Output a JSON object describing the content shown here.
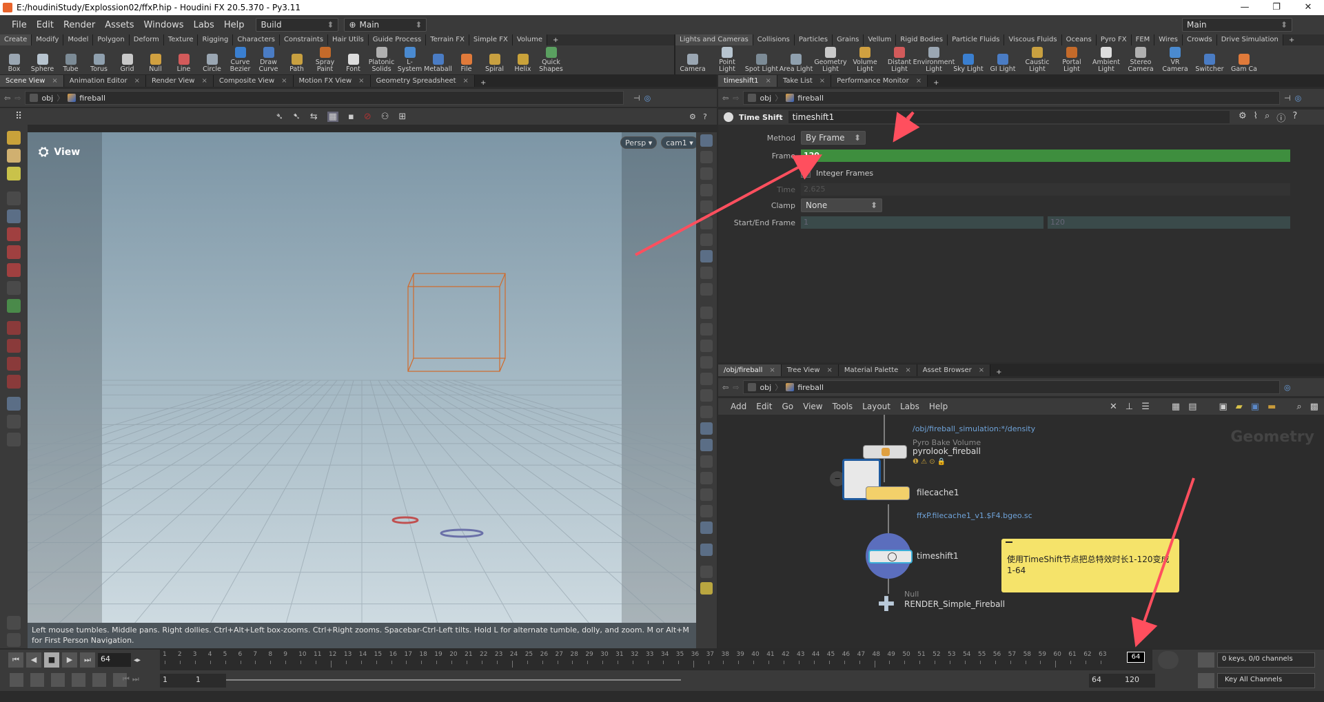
{
  "window": {
    "title": "E:/houdiniStudy/Explossion02/ffxP.hip - Houdini FX 20.5.370 - Py3.11"
  },
  "menu": [
    "File",
    "Edit",
    "Render",
    "Assets",
    "Windows",
    "Labs",
    "Help"
  ],
  "desktop": {
    "build": "Build",
    "main": "Main",
    "right_main": "Main"
  },
  "shelf_left": {
    "tabs": [
      "Create",
      "Modify",
      "Model",
      "Polygon",
      "Deform",
      "Texture",
      "Rigging",
      "Characters",
      "Constraints",
      "Hair Utils",
      "Guide Process",
      "Terrain FX",
      "Simple FX",
      "Volume"
    ],
    "tools": [
      "Box",
      "Sphere",
      "Tube",
      "Torus",
      "Grid",
      "Null",
      "Line",
      "Circle",
      "Curve Bezier",
      "Draw Curve",
      "Path",
      "Spray Paint",
      "Font",
      "Platonic Solids",
      "L-System",
      "Metaball",
      "File",
      "Spiral",
      "Helix",
      "Quick Shapes"
    ]
  },
  "shelf_right": {
    "tabs": [
      "Lights and Cameras",
      "Collisions",
      "Particles",
      "Grains",
      "Vellum",
      "Rigid Bodies",
      "Particle Fluids",
      "Viscous Fluids",
      "Oceans",
      "Pyro FX",
      "FEM",
      "Wires",
      "Crowds",
      "Drive Simulation"
    ],
    "tools": [
      "Camera",
      "Point Light",
      "Spot Light",
      "Area Light",
      "Geometry Light",
      "Volume Light",
      "Distant Light",
      "Environment Light",
      "Sky Light",
      "GI Light",
      "Caustic Light",
      "Portal Light",
      "Ambient Light",
      "Stereo Camera",
      "VR Camera",
      "Switcher",
      "Gam Ca"
    ]
  },
  "viewer": {
    "tabs": [
      "Scene View",
      "Animation Editor",
      "Render View",
      "Composite View",
      "Motion FX View",
      "Geometry Spreadsheet"
    ],
    "path": {
      "root": "obj",
      "node": "fireball"
    },
    "label": "View",
    "persp": "Persp",
    "cam": "cam1",
    "help": "Left mouse tumbles. Middle pans. Right dollies. Ctrl+Alt+Left box-zooms. Ctrl+Right zooms. Spacebar-Ctrl-Left tilts. Hold L for alternate tumble, dolly, and zoom. M or Alt+M for First Person Navigation."
  },
  "params": {
    "tabs": [
      "timeshift1",
      "Take List",
      "Performance Monitor"
    ],
    "path": {
      "root": "obj",
      "node": "fireball"
    },
    "node_type": "Time Shift",
    "node_name": "timeshift1",
    "method_label": "Method",
    "method_value": "By Frame",
    "frame_label": "Frame",
    "frame_value": "120",
    "integer_frames": "Integer Frames",
    "time_label": "Time",
    "time_value": "2.625",
    "clamp_label": "Clamp",
    "clamp_value": "None",
    "startend_label": "Start/End Frame",
    "start_value": "1",
    "end_value": "120"
  },
  "network": {
    "tabs": [
      "/obj/fireball",
      "Tree View",
      "Material Palette",
      "Asset Browser"
    ],
    "path": {
      "root": "obj",
      "node": "fireball"
    },
    "menu": [
      "Add",
      "Edit",
      "Go",
      "View",
      "Tools",
      "Layout",
      "Labs",
      "Help"
    ],
    "context_label": "Geometry",
    "nodes": {
      "density_path": "/obj/fireball_simulation:*/density",
      "pyro_type": "Pyro Bake Volume",
      "pyro_name": "pyrolook_fireball",
      "filecache_name": "filecache1",
      "filecache_path": "ffxP.filecache1_v1.$F4.bgeo.sc",
      "timeshift_name": "timeshift1",
      "null_type": "Null",
      "null_name": "RENDER_Simple_Fireball"
    },
    "note": "使用TimeShift节点把总特效时长1-120变成1-64"
  },
  "timeline": {
    "current_frame": "64",
    "ticks": [
      "1",
      "2",
      "3",
      "4",
      "5",
      "6",
      "7",
      "8",
      "9",
      "10",
      "11",
      "12",
      "13",
      "14",
      "15",
      "16",
      "17",
      "18",
      "19",
      "20",
      "21",
      "22",
      "23",
      "24",
      "25",
      "26",
      "27",
      "28",
      "29",
      "30",
      "31",
      "32",
      "33",
      "34",
      "35",
      "36",
      "37",
      "38",
      "39",
      "40",
      "41",
      "42",
      "43",
      "44",
      "45",
      "46",
      "47",
      "48",
      "49",
      "50",
      "51",
      "52",
      "53",
      "54",
      "55",
      "56",
      "57",
      "58",
      "59",
      "60",
      "61",
      "62",
      "63"
    ],
    "marker": "64",
    "range_start": "1",
    "range_start2": "1",
    "range_end_a": "64",
    "range_end_b": "120",
    "keys": "0 keys, 0/0 channels",
    "key_all": "Key All Channels"
  },
  "colors": {
    "accent_green": "#3e8e3e",
    "arrow_red": "#ff4f5e",
    "note_yellow": "#f5e36a",
    "viewport_top": "#8ea6b4",
    "viewport_bottom": "#c8d6de"
  }
}
